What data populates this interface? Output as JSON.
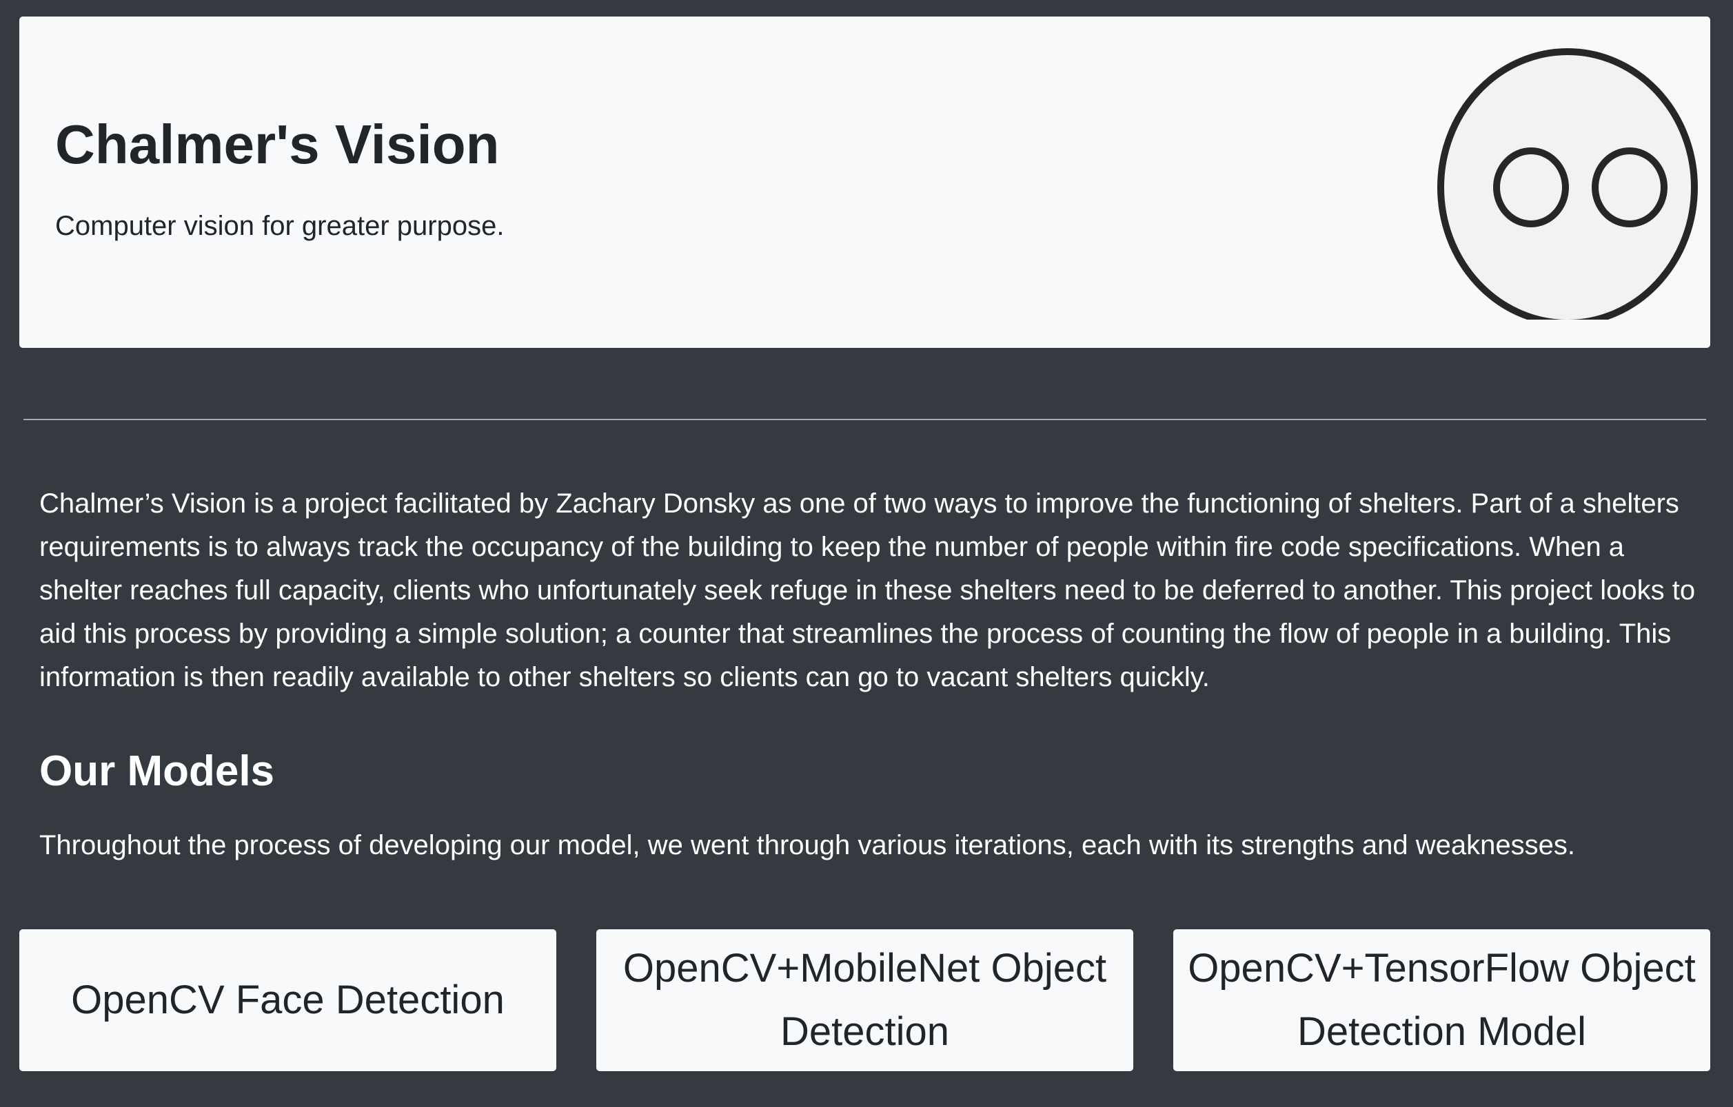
{
  "hero": {
    "title": "Chalmer's Vision",
    "subtitle": "Computer vision for greater purpose.",
    "logo_icon": "eyes-face-logo-icon"
  },
  "about": {
    "text": "Chalmer’s Vision is a project facilitated by Zachary Donsky as one of two ways to improve the functioning of shelters. Part of a shelters requirements is to always track the occupancy of the building to keep the number of people within fire code specifications. When a shelter reaches full capacity, clients who unfortunately seek refuge in these shelters need to be deferred to another. This project looks to aid this process by providing a simple solution; a counter that streamlines the process of counting the flow of people in a building. This information is then readily available to other shelters so clients can go to vacant shelters quickly."
  },
  "models": {
    "heading": "Our Models",
    "description": "Throughout the process of developing our model, we went through various iterations, each with its strengths and weaknesses.",
    "cards": [
      {
        "label": "OpenCV Face Detection"
      },
      {
        "label": "OpenCV+MobileNet Object Detection"
      },
      {
        "label": "OpenCV+TensorFlow Object Detection Model"
      }
    ]
  },
  "colors": {
    "page_background": "#343a40",
    "card_background": "#f8f9fa",
    "dark_text": "#212529",
    "light_text": "#ffffff"
  }
}
